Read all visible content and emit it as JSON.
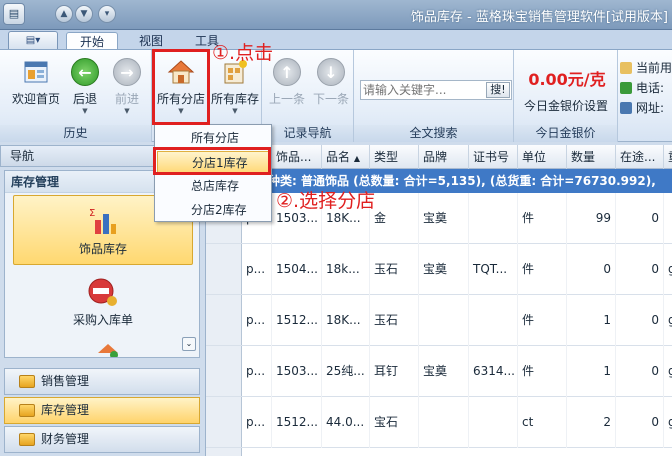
{
  "window": {
    "title": "饰品库存 - 蓝格珠宝销售管理软件[试用版本]"
  },
  "tabs": [
    {
      "label": "开始"
    },
    {
      "label": "视图"
    },
    {
      "label": "工具"
    }
  ],
  "ribbon": {
    "history": {
      "label": "历史",
      "home": "欢迎首页",
      "back": "后退",
      "forward": "前进"
    },
    "store": {
      "all_branches": "所有分店",
      "all_stock": "所有库存"
    },
    "record_nav": {
      "label": "记录导航",
      "prev": "上一条",
      "next": "下一条"
    },
    "search": {
      "label": "全文搜索",
      "placeholder": "请输入关键字...",
      "button": "搜!"
    },
    "gold": {
      "label": "今日金银价",
      "price": "0.00元/克",
      "settings": "今日金银价设置"
    },
    "side_links": [
      "当前用",
      "电话:",
      "网址:"
    ]
  },
  "annotations": {
    "step1": "①.点击",
    "step2": "②.选择分店"
  },
  "branch_menu": {
    "items": [
      "所有分店",
      "分店1库存",
      "总店库存",
      "分店2库存"
    ],
    "highlighted": "分店1库存"
  },
  "nav": {
    "header": "导航",
    "panel_title": "库存管理",
    "items": [
      {
        "label": "饰品库存",
        "icon": "bar-chart-icon",
        "active": true
      },
      {
        "label": "采购入库单",
        "icon": "no-entry-icon",
        "active": false
      }
    ],
    "bars": [
      {
        "label": "销售管理",
        "active": false
      },
      {
        "label": "库存管理",
        "active": true
      },
      {
        "label": "财务管理",
        "active": false
      }
    ]
  },
  "grid": {
    "columns": [
      "",
      "饰品...",
      "品名",
      "类型",
      "品牌",
      "证书号",
      "单位",
      "数量",
      "在途...",
      "重"
    ],
    "group_row": "种类: 普通饰品 (总数量: 合计=5,135), (总货重: 合计=76730.992),",
    "rows": [
      {
        "a": "p...",
        "code": "1503...",
        "name": "18K...",
        "type": "金",
        "brand": "宝奠",
        "cert": "",
        "unit": "件",
        "qty": "99",
        "transit": "0",
        "weight": ""
      },
      {
        "a": "p...",
        "code": "1504...",
        "name": "18k...",
        "type": "玉石",
        "brand": "宝奠",
        "cert": "TQT...",
        "unit": "件",
        "qty": "0",
        "transit": "0",
        "weight": "g"
      },
      {
        "a": "p...",
        "code": "1512...",
        "name": "18K...",
        "type": "玉石",
        "brand": "",
        "cert": "",
        "unit": "件",
        "qty": "1",
        "transit": "0",
        "weight": "g"
      },
      {
        "a": "p...",
        "code": "1503...",
        "name": "25纯...",
        "type": "耳钉",
        "brand": "宝奠",
        "cert": "6314...",
        "unit": "件",
        "qty": "1",
        "transit": "0",
        "weight": "g"
      },
      {
        "a": "p...",
        "code": "1512...",
        "name": "44.0...",
        "type": "宝石",
        "brand": "",
        "cert": "",
        "unit": "ct",
        "qty": "2",
        "transit": "0",
        "weight": "g"
      }
    ]
  },
  "colors": {
    "accent_red": "#e02020",
    "group_blue": "#3f79c6",
    "highlight_yellow": "#ffd870"
  }
}
